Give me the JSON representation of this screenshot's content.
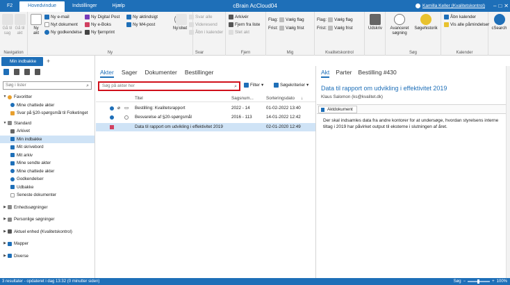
{
  "titlebar": {
    "tabs": [
      "F2",
      "Hovedvindue",
      "Indstillinger",
      "Hjælp"
    ],
    "app_title": "cBrain AcCloud04",
    "user": "Kamilla Keller (Kvalitetskontrol)"
  },
  "ribbon": {
    "navigation": {
      "back": "Gå til sag",
      "forward": "Gå til akt",
      "label": "Navigation"
    },
    "ny": {
      "big": "Ny akt",
      "items": [
        "Ny e-mail",
        "Nyt dokument",
        "Ny godkendelse",
        "Ny Digital Post",
        "Ny e-Boks",
        "Ny fjernprint",
        "Ny aktindsigt",
        "Ny M4-post"
      ],
      "chat": "Ny chat",
      "label": "Ny"
    },
    "svar": {
      "big": "Svar",
      "items": [
        "Svar alle",
        "Videresend",
        "Åbn i kalender"
      ],
      "label": "Svar"
    },
    "fjern": {
      "items": [
        "Arkivér",
        "Fjern fra liste",
        "Slet akt"
      ],
      "label": "Fjern"
    },
    "mig": {
      "row1_label": "Flag:",
      "row1_value": "Vælg flag",
      "row2_label": "Frist:",
      "row2_value": "Vælg frist",
      "label": "Mig"
    },
    "kvalitet": {
      "row1_label": "Flag:",
      "row1_value": "Vælg flag",
      "row2_label": "Frist:",
      "row2_value": "Vælg frist",
      "label": "Kvalitetskontrol"
    },
    "udskriv": {
      "big": "Udskriv"
    },
    "sog": {
      "adv": "Avanceret søgning",
      "hist": "Søgehistorik",
      "label": "Søg"
    },
    "kalender": {
      "items": [
        "Åbn kalender",
        "Vis alle påmindelser"
      ],
      "label": "Kalender"
    },
    "csearch": {
      "big": "cSearch"
    }
  },
  "left": {
    "tab": "Min indbakke",
    "search_placeholder": "Søg i lister",
    "tree": {
      "favoritter": "Favoritter",
      "fav_items": [
        "Mine chattede akter",
        "Svar på §20-spørgsmål til Folketinget"
      ],
      "standard": "Standard",
      "std_items": [
        "Arkivet",
        "Min indbakke",
        "Mit skrivebord",
        "Mit arkiv",
        "Mine sendte akter",
        "Mine chattede akter",
        "Godkendelser",
        "Udbakke",
        "Seneste dokumenter"
      ],
      "groups": [
        "Enhedssøgninger",
        "Personlige søgninger",
        "Aktuel enhed (Kvalitetskontrol)",
        "Mapper",
        "Diverse"
      ]
    }
  },
  "middle": {
    "tabs": [
      "Akter",
      "Sager",
      "Dokumenter",
      "Bestillinger"
    ],
    "search_placeholder": "Søg på akter her",
    "filter": "Filter",
    "criteria": "Søgekriterier",
    "columns": {
      "title": "Titel",
      "casenum": "Sagsnum...",
      "sortdate": "Sorteringsdato"
    },
    "rows": [
      {
        "title": "Bestilling: Kvalitetsrapport",
        "casenum": "2022 - 14",
        "date": "01-02-2022 13:40"
      },
      {
        "title": "Besvarelse af §20-spørgsmål",
        "casenum": "2016 - 113",
        "date": "14-01-2022 12:42"
      },
      {
        "title": "Data til rapport om udvikling i effektivitet 2019",
        "casenum": "",
        "date": "02-01-2020 12:49"
      }
    ]
  },
  "right": {
    "tabs": [
      "Akt",
      "Parter",
      "Bestilling #430"
    ],
    "doc_title": "Data til rapport om udvikling i effektivitet 2019",
    "author": "Klaus Salomon (ks@kvalitet.dk)",
    "doc_tab": "Aktdokument",
    "body": "Der skal indsamles data fra andre kontorer for at undersøge, hvordan styrelsens interne tiltag i 2019 har påvirket output til eksterne i slutningen af året."
  },
  "status": {
    "text": "3 resultater - opdateret i dag 13:32 (0 minutter siden)",
    "zoom_label": "Søg",
    "zoom": "100%"
  },
  "colors": {
    "accent": "#1e6fb8",
    "selection": "#cfe3f6",
    "search_border": "#d0101a"
  }
}
